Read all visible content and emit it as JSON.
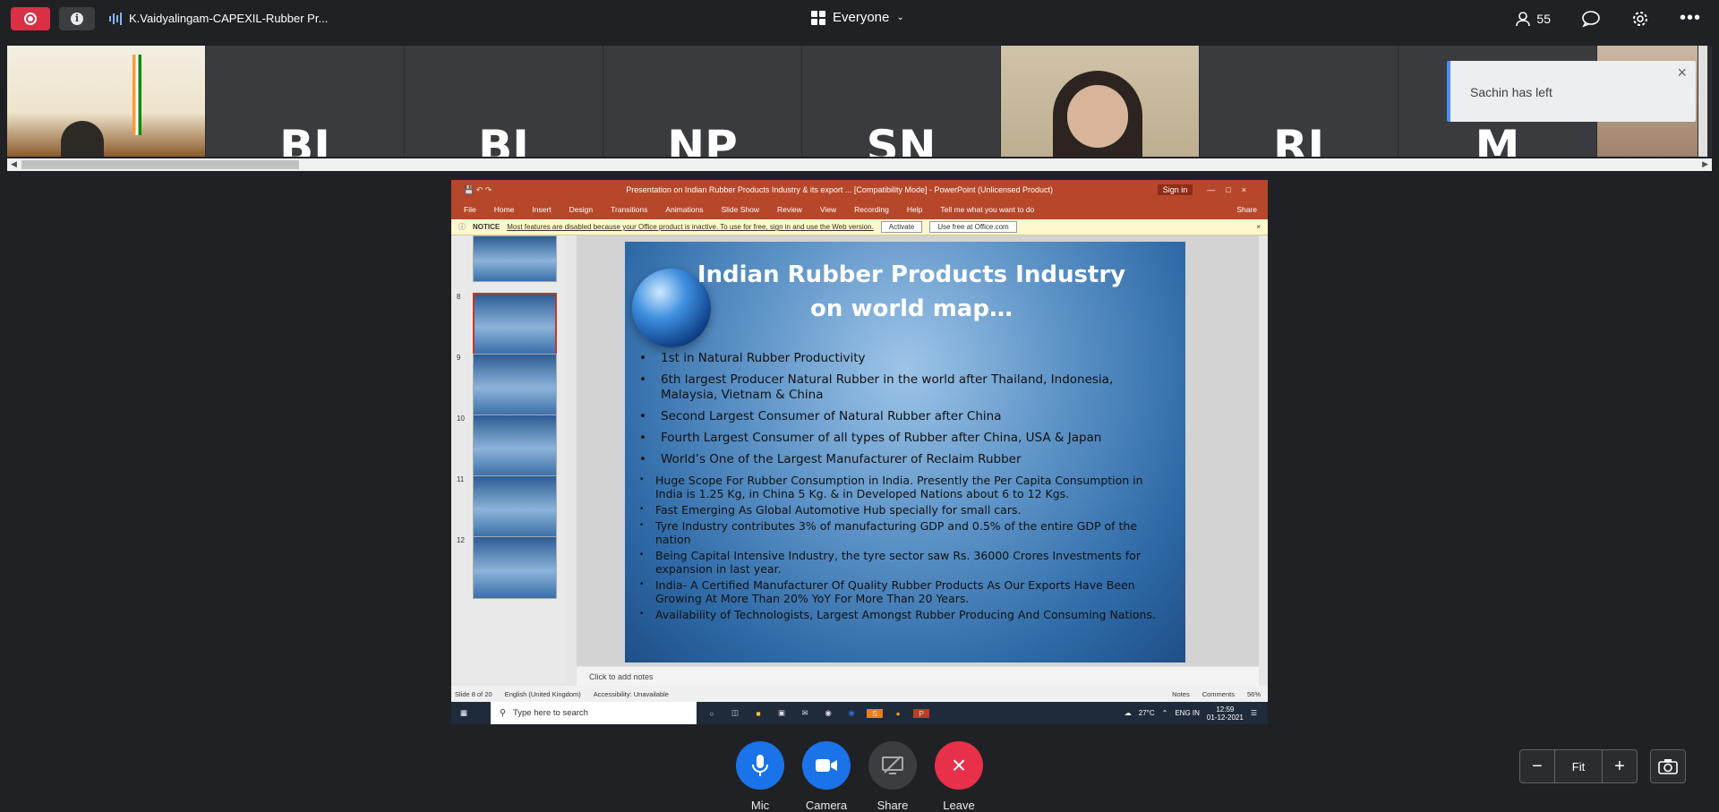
{
  "header": {
    "meeting_title": "K.Vaidyalingam-CAPEXIL-Rubber Pr...",
    "view_mode": "Everyone",
    "participant_count": "55"
  },
  "participants": [
    {
      "initials": ""
    },
    {
      "initials": "BI"
    },
    {
      "initials": "BI"
    },
    {
      "initials": "NP"
    },
    {
      "initials": "SN"
    },
    {
      "initials": ""
    },
    {
      "initials": "RI"
    },
    {
      "initials": "M"
    },
    {
      "initials": ""
    }
  ],
  "toast": {
    "message": "Sachin has left"
  },
  "powerpoint": {
    "window_title": "Presentation on Indian Rubber Products Industry & its export ... [Compatibility Mode] - PowerPoint (Unlicensed Product)",
    "sign_in": "Sign in",
    "ribbon_tabs": [
      "File",
      "Home",
      "Insert",
      "Design",
      "Transitions",
      "Animations",
      "Slide Show",
      "Review",
      "View",
      "Recording",
      "Help"
    ],
    "tell_me": "Tell me what you want to do",
    "share_label": "Share",
    "notice_label": "NOTICE",
    "notice_text": "Most features are disabled because your Office product is inactive. To use for free, sign in and use the Web version.",
    "activate_label": "Activate",
    "use_free_label": "Use free at Office.com",
    "thumb_numbers": [
      "8",
      "9",
      "10",
      "11",
      "12"
    ],
    "notes_placeholder": "Click to add notes",
    "status_slide": "Slide 8 of 20",
    "status_language": "English (United Kingdom)",
    "status_accessibility": "Accessibility: Unavailable",
    "status_notes": "Notes",
    "status_comments": "Comments",
    "status_zoom": "56%"
  },
  "slide": {
    "title_line1": "Indian Rubber Products Industry",
    "title_line2": "on world map…",
    "bullets": [
      "1st in Natural Rubber Productivity",
      "6th largest Producer Natural Rubber in the world after Thailand, Indonesia, Malaysia, Vietnam & China",
      "Second Largest Consumer of Natural Rubber after China",
      "Fourth Largest Consumer of all types of Rubber after China, USA & Japan",
      "World’s One of the Largest Manufacturer of Reclaim Rubber"
    ],
    "sub_bullets": [
      "Huge Scope For Rubber Consumption in India. Presently the Per Capita Consumption in India is 1.25 Kg, in China 5 Kg. & in Developed Nations about 6 to 12 Kgs.",
      "Fast Emerging As Global Automotive Hub specially for small cars.",
      "Tyre Industry contributes 3% of manufacturing GDP and 0.5% of the entire  GDP  of the nation",
      "Being Capital Intensive Industry, the tyre sector saw Rs. 36000 Crores Investments for expansion in last year.",
      "India- A Certified Manufacturer Of Quality Rubber Products As Our Exports Have Been Growing  At  More Than 20%  YoY  For More Than 20 Years.",
      "Availability  of  Technologists, Largest Amongst Rubber Producing And Consuming Nations."
    ]
  },
  "taskbar": {
    "search_placeholder": "Type here to search",
    "temperature": "27°C",
    "lang": "ENG IN",
    "time": "12:59",
    "date": "01-12-2021"
  },
  "controls": {
    "mic": "Mic",
    "camera": "Camera",
    "share": "Share",
    "leave": "Leave",
    "zoom_fit": "Fit"
  }
}
